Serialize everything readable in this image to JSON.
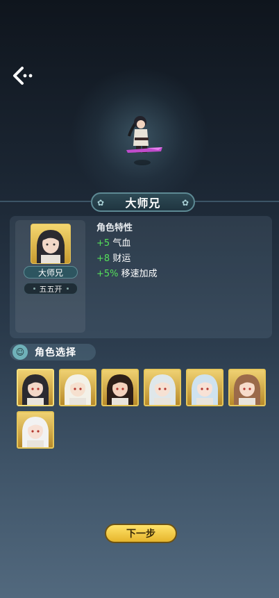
{
  "character": {
    "name": "大师兄",
    "tag": "五五开",
    "traits_title": "角色特性",
    "traits": [
      {
        "value": "+5",
        "label": "气血"
      },
      {
        "value": "+8",
        "label": "财运"
      },
      {
        "value": "+5%",
        "label": "移速加成"
      }
    ]
  },
  "selection": {
    "title": "角色选择",
    "characters": [
      {
        "name": "大师兄",
        "hair": "#2b2a30",
        "skin": "#f2d8c8",
        "selected": true
      },
      {
        "name": "character-2",
        "hair": "#f3f1e8",
        "skin": "#f6e0cf",
        "selected": false
      },
      {
        "name": "character-3",
        "hair": "#2d1e18",
        "skin": "#f4d2bd",
        "selected": false
      },
      {
        "name": "character-4",
        "hair": "#dfe7ea",
        "skin": "#f6e1d3",
        "selected": false
      },
      {
        "name": "character-5",
        "hair": "#cfe2ef",
        "skin": "#f8e2d6",
        "selected": false
      },
      {
        "name": "character-6",
        "hair": "#9b6a4a",
        "skin": "#f7dccb",
        "selected": false
      },
      {
        "name": "character-7",
        "hair": "#f2f2f2",
        "skin": "#f7e0d5",
        "selected": false
      }
    ]
  },
  "buttons": {
    "next": "下一步"
  },
  "icons": {
    "back": "back-arrow-icon",
    "flower": "✿"
  },
  "colors": {
    "trait_green": "#55e05a",
    "gold": "#e6c65a"
  }
}
